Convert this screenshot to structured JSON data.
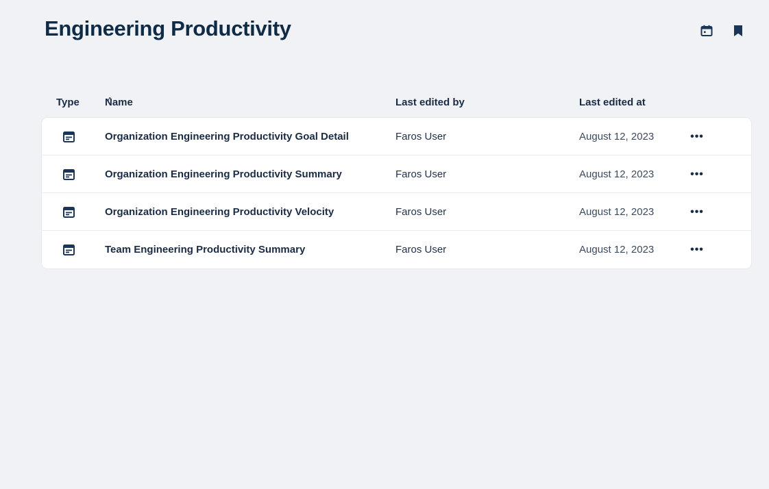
{
  "page": {
    "title": "Engineering Productivity"
  },
  "header_actions": {
    "icons": [
      "calendar-icon",
      "bookmark-icon"
    ]
  },
  "table": {
    "columns": {
      "type": "Type",
      "name": "Name",
      "name_sort_indicator": "^",
      "editor": "Last edited by",
      "date": "Last edited at"
    },
    "rows": [
      {
        "type_icon": "dashboard-icon",
        "name": "Organization Engineering Productivity Goal Detail",
        "editor": "Faros User",
        "date": "August 12, 2023",
        "menu": "•••"
      },
      {
        "type_icon": "dashboard-icon",
        "name": "Organization Engineering Productivity Summary",
        "editor": "Faros User",
        "date": "August 12, 2023",
        "menu": "•••"
      },
      {
        "type_icon": "dashboard-icon",
        "name": "Organization Engineering Productivity Velocity",
        "editor": "Faros User",
        "date": "August 12, 2023",
        "menu": "•••"
      },
      {
        "type_icon": "dashboard-icon",
        "name": "Team Engineering Productivity Summary",
        "editor": "Faros User",
        "date": "August 12, 2023",
        "menu": "•••"
      }
    ]
  },
  "colors": {
    "background": "#f0f2f6",
    "title": "#0f2b46",
    "text": "#1a2b44",
    "card": "#ffffff",
    "icon": "#1a3556"
  }
}
